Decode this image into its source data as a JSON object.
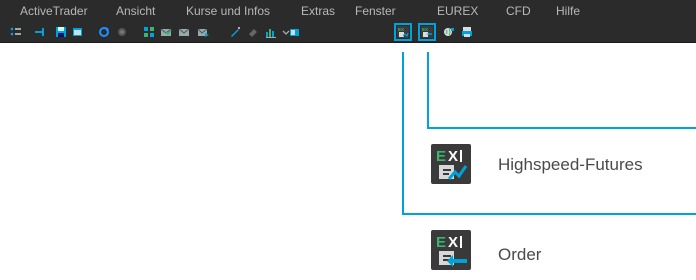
{
  "menu": {
    "items": [
      {
        "id": "activetrader",
        "label": "ActiveTrader"
      },
      {
        "id": "ansicht",
        "label": "Ansicht"
      },
      {
        "id": "kurse",
        "label": "Kurse und Infos"
      },
      {
        "id": "extras",
        "label": "Extras"
      },
      {
        "id": "fenster",
        "label": "Fenster"
      },
      {
        "id": "eurex",
        "label": "EUREX"
      },
      {
        "id": "cfd",
        "label": "CFD"
      },
      {
        "id": "hilfe",
        "label": "Hilfe"
      }
    ]
  },
  "toolbar": {
    "icons": [
      "list-icon",
      "pin-icon",
      "save-icon",
      "window-icon",
      "refresh-icon",
      "stop-icon",
      "layout-icon",
      "mail-check-icon",
      "mail-icon",
      "mail-send-icon",
      "pen-icon",
      "eraser-icon",
      "chart-icon",
      "chevron-down-icon",
      "rss-icon",
      "eurex-highspeed-futures-icon",
      "eurex-order-icon",
      "globe-icon",
      "eurex-print-icon"
    ],
    "highlight_color": "#00a3d9"
  },
  "callouts": [
    {
      "label": "Highspeed-Futures",
      "icon": "eurex-highspeed-futures-icon"
    },
    {
      "label": "Order",
      "icon": "eurex-order-icon"
    }
  ],
  "colors": {
    "menubar_bg": "#2b2b2b",
    "menu_text": "#b8b8b8",
    "accent": "#00a3d9",
    "eurex_green": "#3cb371",
    "label_text": "#4a4a4a"
  }
}
